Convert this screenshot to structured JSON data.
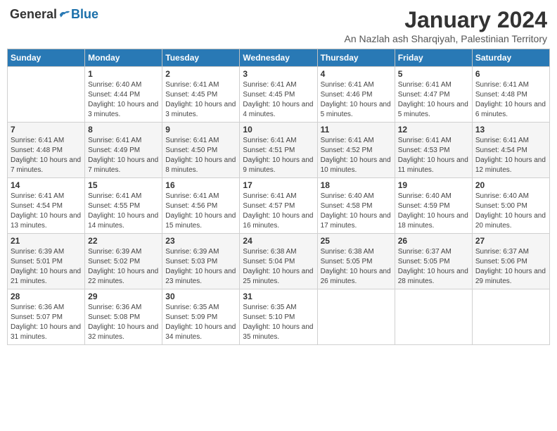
{
  "logo": {
    "general": "General",
    "blue": "Blue"
  },
  "title": "January 2024",
  "location": "An Nazlah ash Sharqiyah, Palestinian Territory",
  "weekdays": [
    "Sunday",
    "Monday",
    "Tuesday",
    "Wednesday",
    "Thursday",
    "Friday",
    "Saturday"
  ],
  "rows": [
    {
      "cells": [
        {
          "day": "",
          "sunrise": "",
          "sunset": "",
          "daylight": ""
        },
        {
          "day": "1",
          "sunrise": "Sunrise: 6:40 AM",
          "sunset": "Sunset: 4:44 PM",
          "daylight": "Daylight: 10 hours and 3 minutes."
        },
        {
          "day": "2",
          "sunrise": "Sunrise: 6:41 AM",
          "sunset": "Sunset: 4:45 PM",
          "daylight": "Daylight: 10 hours and 3 minutes."
        },
        {
          "day": "3",
          "sunrise": "Sunrise: 6:41 AM",
          "sunset": "Sunset: 4:45 PM",
          "daylight": "Daylight: 10 hours and 4 minutes."
        },
        {
          "day": "4",
          "sunrise": "Sunrise: 6:41 AM",
          "sunset": "Sunset: 4:46 PM",
          "daylight": "Daylight: 10 hours and 5 minutes."
        },
        {
          "day": "5",
          "sunrise": "Sunrise: 6:41 AM",
          "sunset": "Sunset: 4:47 PM",
          "daylight": "Daylight: 10 hours and 5 minutes."
        },
        {
          "day": "6",
          "sunrise": "Sunrise: 6:41 AM",
          "sunset": "Sunset: 4:48 PM",
          "daylight": "Daylight: 10 hours and 6 minutes."
        }
      ]
    },
    {
      "cells": [
        {
          "day": "7",
          "sunrise": "Sunrise: 6:41 AM",
          "sunset": "Sunset: 4:48 PM",
          "daylight": "Daylight: 10 hours and 7 minutes."
        },
        {
          "day": "8",
          "sunrise": "Sunrise: 6:41 AM",
          "sunset": "Sunset: 4:49 PM",
          "daylight": "Daylight: 10 hours and 7 minutes."
        },
        {
          "day": "9",
          "sunrise": "Sunrise: 6:41 AM",
          "sunset": "Sunset: 4:50 PM",
          "daylight": "Daylight: 10 hours and 8 minutes."
        },
        {
          "day": "10",
          "sunrise": "Sunrise: 6:41 AM",
          "sunset": "Sunset: 4:51 PM",
          "daylight": "Daylight: 10 hours and 9 minutes."
        },
        {
          "day": "11",
          "sunrise": "Sunrise: 6:41 AM",
          "sunset": "Sunset: 4:52 PM",
          "daylight": "Daylight: 10 hours and 10 minutes."
        },
        {
          "day": "12",
          "sunrise": "Sunrise: 6:41 AM",
          "sunset": "Sunset: 4:53 PM",
          "daylight": "Daylight: 10 hours and 11 minutes."
        },
        {
          "day": "13",
          "sunrise": "Sunrise: 6:41 AM",
          "sunset": "Sunset: 4:54 PM",
          "daylight": "Daylight: 10 hours and 12 minutes."
        }
      ]
    },
    {
      "cells": [
        {
          "day": "14",
          "sunrise": "Sunrise: 6:41 AM",
          "sunset": "Sunset: 4:54 PM",
          "daylight": "Daylight: 10 hours and 13 minutes."
        },
        {
          "day": "15",
          "sunrise": "Sunrise: 6:41 AM",
          "sunset": "Sunset: 4:55 PM",
          "daylight": "Daylight: 10 hours and 14 minutes."
        },
        {
          "day": "16",
          "sunrise": "Sunrise: 6:41 AM",
          "sunset": "Sunset: 4:56 PM",
          "daylight": "Daylight: 10 hours and 15 minutes."
        },
        {
          "day": "17",
          "sunrise": "Sunrise: 6:41 AM",
          "sunset": "Sunset: 4:57 PM",
          "daylight": "Daylight: 10 hours and 16 minutes."
        },
        {
          "day": "18",
          "sunrise": "Sunrise: 6:40 AM",
          "sunset": "Sunset: 4:58 PM",
          "daylight": "Daylight: 10 hours and 17 minutes."
        },
        {
          "day": "19",
          "sunrise": "Sunrise: 6:40 AM",
          "sunset": "Sunset: 4:59 PM",
          "daylight": "Daylight: 10 hours and 18 minutes."
        },
        {
          "day": "20",
          "sunrise": "Sunrise: 6:40 AM",
          "sunset": "Sunset: 5:00 PM",
          "daylight": "Daylight: 10 hours and 20 minutes."
        }
      ]
    },
    {
      "cells": [
        {
          "day": "21",
          "sunrise": "Sunrise: 6:39 AM",
          "sunset": "Sunset: 5:01 PM",
          "daylight": "Daylight: 10 hours and 21 minutes."
        },
        {
          "day": "22",
          "sunrise": "Sunrise: 6:39 AM",
          "sunset": "Sunset: 5:02 PM",
          "daylight": "Daylight: 10 hours and 22 minutes."
        },
        {
          "day": "23",
          "sunrise": "Sunrise: 6:39 AM",
          "sunset": "Sunset: 5:03 PM",
          "daylight": "Daylight: 10 hours and 23 minutes."
        },
        {
          "day": "24",
          "sunrise": "Sunrise: 6:38 AM",
          "sunset": "Sunset: 5:04 PM",
          "daylight": "Daylight: 10 hours and 25 minutes."
        },
        {
          "day": "25",
          "sunrise": "Sunrise: 6:38 AM",
          "sunset": "Sunset: 5:05 PM",
          "daylight": "Daylight: 10 hours and 26 minutes."
        },
        {
          "day": "26",
          "sunrise": "Sunrise: 6:37 AM",
          "sunset": "Sunset: 5:05 PM",
          "daylight": "Daylight: 10 hours and 28 minutes."
        },
        {
          "day": "27",
          "sunrise": "Sunrise: 6:37 AM",
          "sunset": "Sunset: 5:06 PM",
          "daylight": "Daylight: 10 hours and 29 minutes."
        }
      ]
    },
    {
      "cells": [
        {
          "day": "28",
          "sunrise": "Sunrise: 6:36 AM",
          "sunset": "Sunset: 5:07 PM",
          "daylight": "Daylight: 10 hours and 31 minutes."
        },
        {
          "day": "29",
          "sunrise": "Sunrise: 6:36 AM",
          "sunset": "Sunset: 5:08 PM",
          "daylight": "Daylight: 10 hours and 32 minutes."
        },
        {
          "day": "30",
          "sunrise": "Sunrise: 6:35 AM",
          "sunset": "Sunset: 5:09 PM",
          "daylight": "Daylight: 10 hours and 34 minutes."
        },
        {
          "day": "31",
          "sunrise": "Sunrise: 6:35 AM",
          "sunset": "Sunset: 5:10 PM",
          "daylight": "Daylight: 10 hours and 35 minutes."
        },
        {
          "day": "",
          "sunrise": "",
          "sunset": "",
          "daylight": ""
        },
        {
          "day": "",
          "sunrise": "",
          "sunset": "",
          "daylight": ""
        },
        {
          "day": "",
          "sunrise": "",
          "sunset": "",
          "daylight": ""
        }
      ]
    }
  ]
}
